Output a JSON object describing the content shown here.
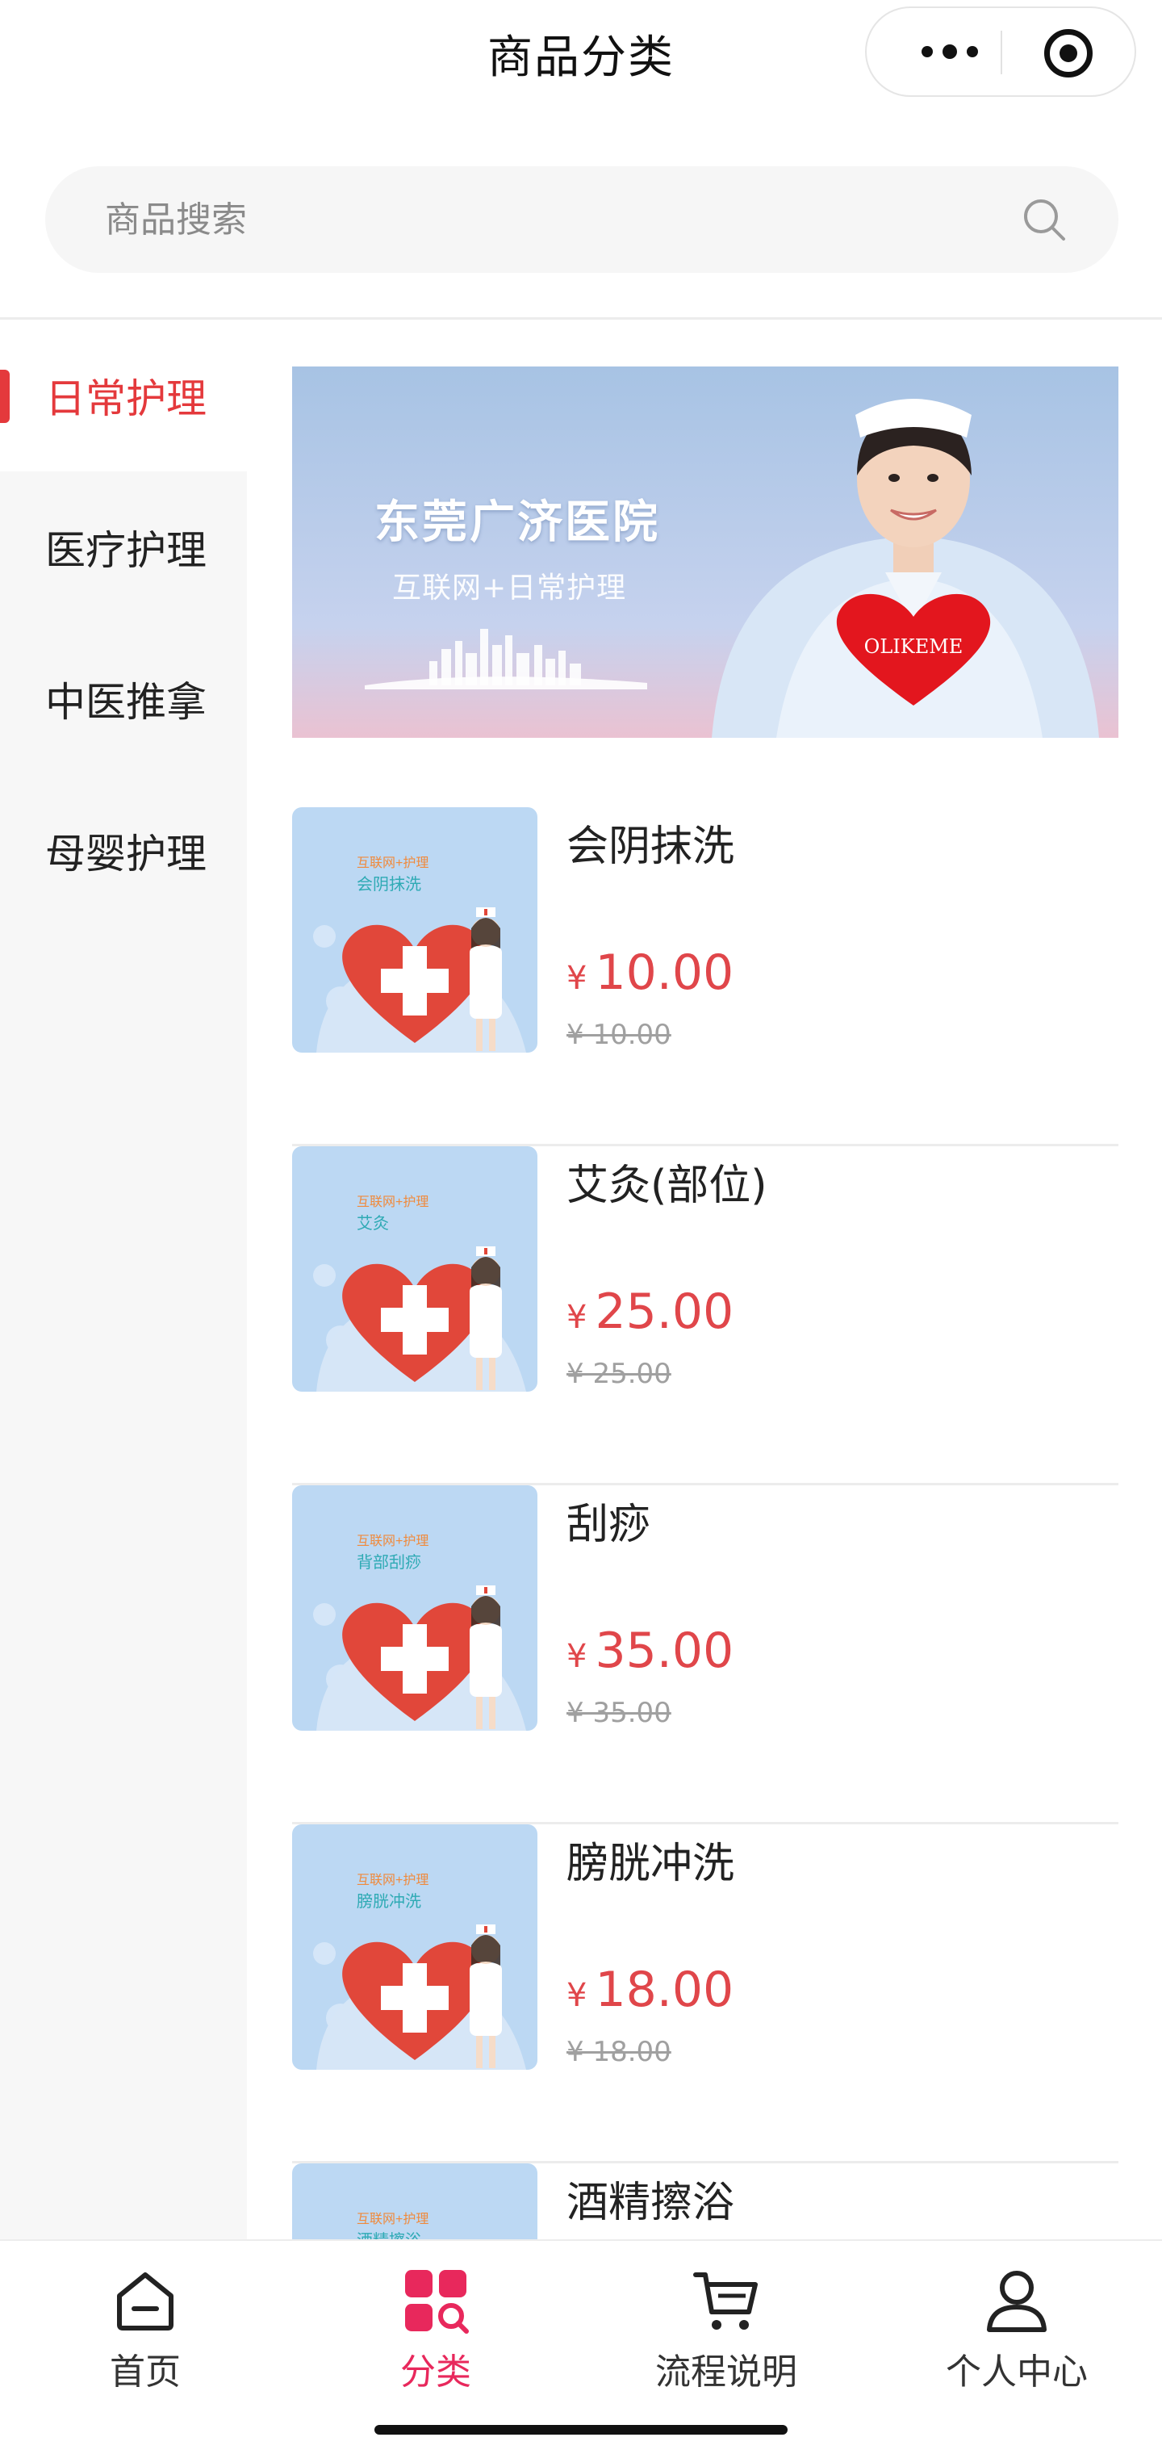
{
  "header": {
    "title": "商品分类"
  },
  "search": {
    "placeholder": "商品搜索"
  },
  "categories": [
    {
      "label": "日常护理",
      "active": true
    },
    {
      "label": "医疗护理",
      "active": false
    },
    {
      "label": "中医推拿",
      "active": false
    },
    {
      "label": "母婴护理",
      "active": false
    }
  ],
  "banner": {
    "title": "东莞广济医院",
    "subtitle": "互联网+日常护理",
    "heart_text": "OLIKEME"
  },
  "products": [
    {
      "name": "会阴抹洗",
      "currency": "¥",
      "price": "10.00",
      "original": "¥ 10.00",
      "thumb_tag": "互联网+护理",
      "thumb_title": "会阴抹洗"
    },
    {
      "name": "艾灸(部位)",
      "currency": "¥",
      "price": "25.00",
      "original": "¥ 25.00",
      "thumb_tag": "互联网+护理",
      "thumb_title": "艾灸"
    },
    {
      "name": "刮痧",
      "currency": "¥",
      "price": "35.00",
      "original": "¥ 35.00",
      "thumb_tag": "互联网+护理",
      "thumb_title": "背部刮痧"
    },
    {
      "name": "膀胱冲洗",
      "currency": "¥",
      "price": "18.00",
      "original": "¥ 18.00",
      "thumb_tag": "互联网+护理",
      "thumb_title": "膀胱冲洗"
    },
    {
      "name": "酒精擦浴",
      "currency": "¥",
      "price": "",
      "original": "",
      "thumb_tag": "互联网+护理",
      "thumb_title": "酒精擦浴"
    }
  ],
  "tabbar": {
    "items": [
      {
        "label": "首页",
        "icon": "home-icon",
        "active": false
      },
      {
        "label": "分类",
        "icon": "category-icon",
        "active": true
      },
      {
        "label": "流程说明",
        "icon": "cart-icon",
        "active": false
      },
      {
        "label": "个人中心",
        "icon": "user-icon",
        "active": false
      }
    ]
  },
  "colors": {
    "accent_red": "#e4393c",
    "price_red": "#e0464a",
    "tab_active": "#e8285c",
    "sidebar_bg": "#f7f7f7"
  }
}
